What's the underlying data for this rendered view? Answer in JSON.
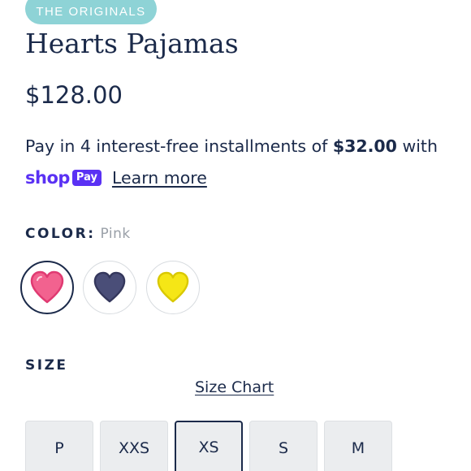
{
  "product": {
    "badge": "THE ORIGINALS",
    "title": "Hearts Pajamas",
    "price": "$128.00"
  },
  "installments": {
    "text_before": "Pay in 4 interest-free installments of ",
    "amount": "$32.00",
    "text_after": " with",
    "shop_word": "shop",
    "pay_word": "Pay",
    "learn_more": "Learn more",
    "brand_color": "#5a31f4"
  },
  "color": {
    "label": "COLOR:",
    "selected": "Pink",
    "swatches": [
      {
        "name": "Pink",
        "icon": "pink-heart-icon",
        "fill": "#f2628f",
        "outline": "#e03a72",
        "selected": true
      },
      {
        "name": "Navy",
        "icon": "navy-heart-icon",
        "fill": "#4a4e78",
        "outline": "#34375c",
        "selected": false
      },
      {
        "name": "Yellow",
        "icon": "yellow-heart-icon",
        "fill": "#f5e616",
        "outline": "#d9c800",
        "selected": false
      }
    ]
  },
  "size": {
    "label": "SIZE",
    "chart_link": "Size Chart",
    "options": [
      "P",
      "XXS",
      "XS",
      "S",
      "M"
    ],
    "selected": "XS"
  },
  "colors": {
    "text": "#1b2a4a",
    "badge_bg": "#8ed3d6",
    "size_bg": "#ebedef",
    "muted": "#9aa0a8"
  }
}
